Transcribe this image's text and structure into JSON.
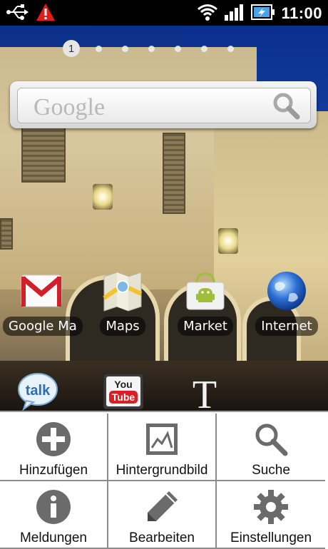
{
  "status_bar": {
    "time": "11:00",
    "icons": [
      "usb-icon",
      "warning-icon",
      "wifi-icon",
      "signal-icon",
      "battery-charging-icon"
    ]
  },
  "home": {
    "page_indicator": {
      "current": "1",
      "total_pages": 7
    },
    "search": {
      "logo_text": "Google",
      "icon": "search-icon"
    },
    "apps": [
      {
        "label": "Google Ma",
        "icon": "gmail-icon"
      },
      {
        "label": "Maps",
        "icon": "maps-icon"
      },
      {
        "label": "Market",
        "icon": "market-icon"
      },
      {
        "label": "Internet",
        "icon": "internet-globe-icon"
      }
    ],
    "dock_apps": [
      {
        "icon": "talk-icon",
        "text": "talk"
      },
      {
        "icon": "youtube-icon",
        "text_top": "You",
        "text_bottom": "Tube"
      },
      {
        "icon": "text-t-icon",
        "text": "T"
      }
    ]
  },
  "menu": {
    "items": [
      {
        "label": "Hinzufügen",
        "icon": "add-icon"
      },
      {
        "label": "Hintergrundbild",
        "icon": "wallpaper-icon"
      },
      {
        "label": "Suche",
        "icon": "search-icon"
      },
      {
        "label": "Meldungen",
        "icon": "info-icon"
      },
      {
        "label": "Bearbeiten",
        "icon": "pencil-icon"
      },
      {
        "label": "Einstellungen",
        "icon": "gear-icon"
      }
    ]
  },
  "colors": {
    "status_bar_bg": "#000000",
    "menu_bg": "#ffffff",
    "menu_divider": "#8c8c8c",
    "warning_red": "#e21b1b",
    "gmail_red": "#d2202a",
    "youtube_red": "#d91e26",
    "internet_blue": "#2c6fd6"
  }
}
